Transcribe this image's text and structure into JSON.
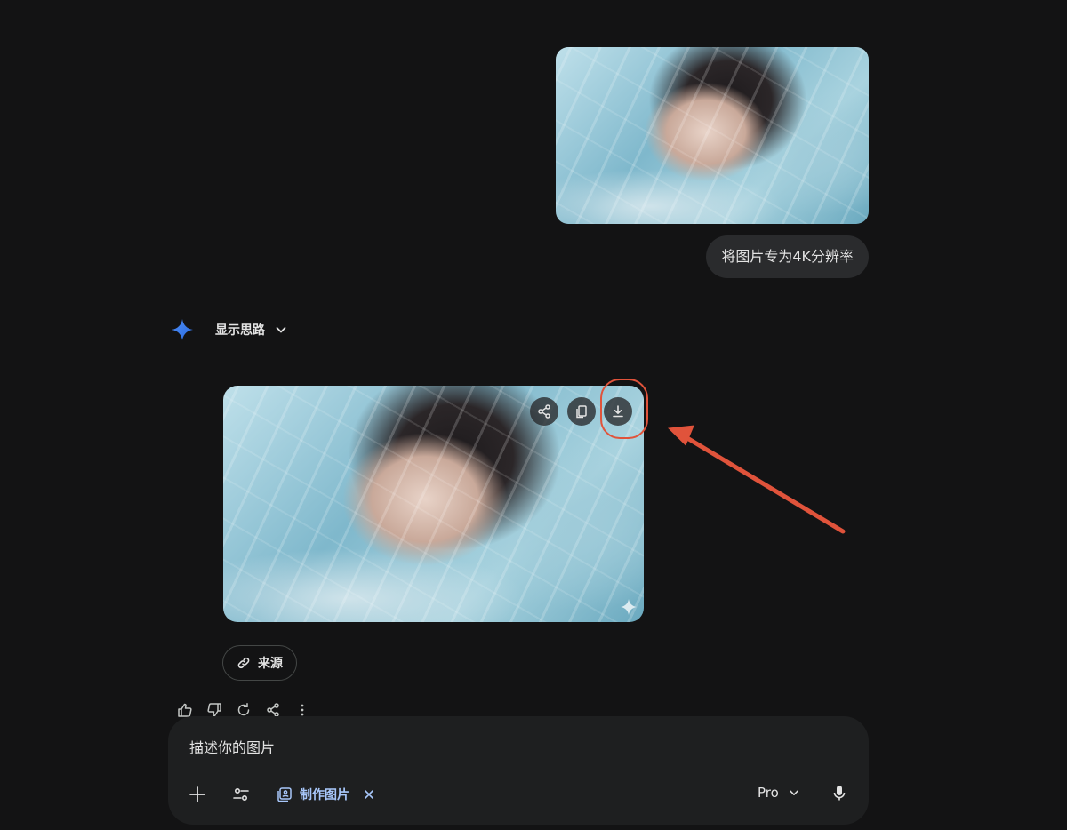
{
  "conversation": {
    "user_message": {
      "image_alt": "uploaded underwater portrait photo",
      "text": "将图片专为4K分辨率"
    },
    "model_response": {
      "show_thinking_label": "显示思路",
      "image_alt": "generated 4K underwater portrait photo",
      "image_actions": [
        "share-icon",
        "copy-icon",
        "download-icon"
      ],
      "source_chip_label": "来源",
      "feedback_actions": [
        "thumbs-up-icon",
        "thumbs-down-icon",
        "regenerate-icon",
        "share-icon",
        "more-vert-icon"
      ]
    }
  },
  "composer": {
    "placeholder": "描述你的图片",
    "tool_chip_label": "制作图片",
    "model_label": "Pro"
  },
  "annotation": {
    "color": "#e0533b",
    "highlighted": "download-button"
  },
  "colors": {
    "background": "#131314",
    "bubble": "#2a2b2d",
    "composer": "#1e1f20",
    "accent": "#a8c7fa"
  }
}
